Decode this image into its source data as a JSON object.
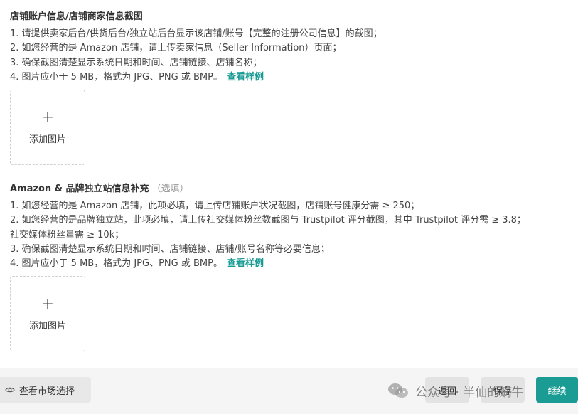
{
  "section1": {
    "title": "店铺账户信息/店铺商家信息截图",
    "lines": [
      "1. 请提供卖家后台/供货后台/独立站后台显示该店铺/账号【完整的注册公司信息】的截图；",
      "2. 如您经营的是 Amazon 店铺，请上传卖家信息（Seller Information）页面；",
      "3. 确保截图清楚显示系统日期和时间、店铺链接、店铺名称；",
      "4. 图片应小于 5 MB，格式为 JPG、PNG 或 BMP。"
    ],
    "view_example": "查看样例",
    "upload_plus": "+",
    "upload_label": "添加图片"
  },
  "section2": {
    "title": "Amazon & 品牌独立站信息补充",
    "optional": "（选填）",
    "lines": [
      "1. 如您经营的是 Amazon 店铺，此项必填，请上传店铺账户状况截图，店铺账号健康分需 ≥ 250；",
      "2. 如您经营的是品牌独立站，此项必填，请上传社交媒体粉丝数截图与 Trustpilot 评分截图，其中 Trustpilot 评分需 ≥ 3.8；",
      "社交媒体粉丝量需 ≥ 10k；",
      "3. 确保截图清楚显示系统日期和时间、店铺链接、店铺/账号名称等必要信息；",
      "4. 图片应小于 5 MB，格式为 JPG、PNG 或 BMP。"
    ],
    "view_example": "查看样例",
    "upload_plus": "+",
    "upload_label": "添加图片"
  },
  "footer": {
    "view_market": "查看市场选择",
    "back": "返回",
    "save": "保存",
    "continue": "继续"
  },
  "watermark": {
    "text": "公众号 · 半仙的蜗牛"
  },
  "colors": {
    "accent": "#1a9c94",
    "footer_bg": "#f5f5f5",
    "button_gray": "#e3e3e3"
  },
  "icons": [
    "plus-icon",
    "eye-icon",
    "wechat-icon"
  ]
}
